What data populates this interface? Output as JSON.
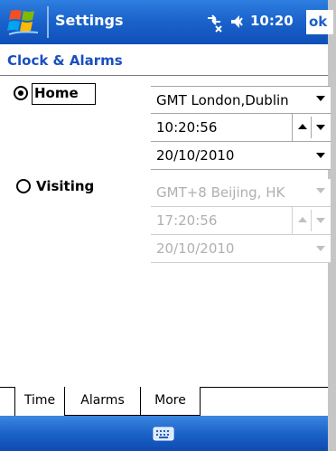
{
  "titlebar": {
    "title": "Settings",
    "time": "10:20",
    "ok_label": "ok",
    "icons": [
      "windows-start-icon",
      "connectivity-icon",
      "volume-icon"
    ]
  },
  "page": {
    "title": "Clock & Alarms"
  },
  "home": {
    "label": "Home",
    "selected": true,
    "timezone": "GMT London,Dublin",
    "time": "10:20:56",
    "date": "20/10/2010"
  },
  "visiting": {
    "label": "Visiting",
    "selected": false,
    "timezone": "GMT+8 Beijing, HK",
    "time": "17:20:56",
    "date": "20/10/2010"
  },
  "tabs": [
    {
      "label": "Time",
      "active": true
    },
    {
      "label": "Alarms",
      "active": false
    },
    {
      "label": "More",
      "active": false
    }
  ],
  "menubar": {
    "icon": "keyboard-icon"
  },
  "colors": {
    "titlebar_blue": "#1b64cc",
    "page_title_blue": "#1a4fc0",
    "disabled_text": "#b0b0b0"
  }
}
